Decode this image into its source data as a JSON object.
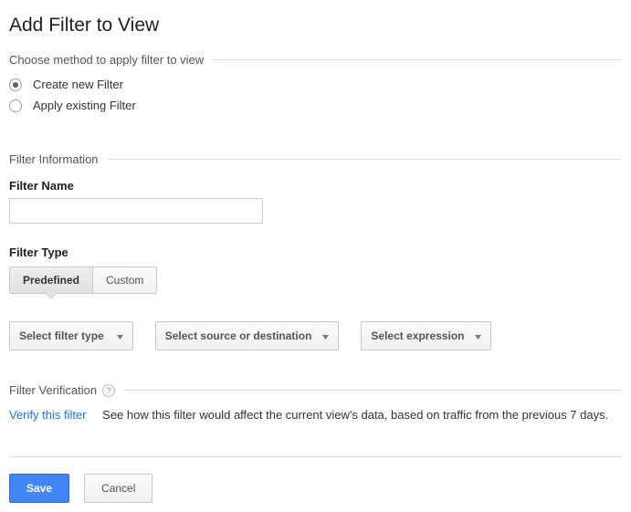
{
  "title": "Add Filter to View",
  "method_section": {
    "heading": "Choose method to apply filter to view",
    "options": {
      "create": "Create new Filter",
      "apply": "Apply existing Filter"
    }
  },
  "info_section": {
    "heading": "Filter Information",
    "name_label": "Filter Name",
    "name_value": "",
    "type_label": "Filter Type",
    "type_tabs": {
      "predefined": "Predefined",
      "custom": "Custom"
    },
    "dropdowns": {
      "filter_type": "Select filter type",
      "source_dest": "Select source or destination",
      "expression": "Select expression"
    }
  },
  "verify_section": {
    "heading": "Filter Verification",
    "link": "Verify this filter",
    "desc": "See how this filter would affect the current view's data, based on traffic from the previous 7 days."
  },
  "buttons": {
    "save": "Save",
    "cancel": "Cancel"
  }
}
